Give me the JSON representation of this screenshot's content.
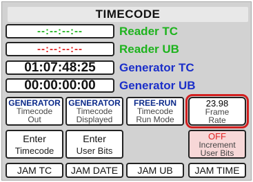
{
  "title": "TIMECODE",
  "colors": {
    "green": "#1db31d",
    "red": "#e22020",
    "blue": "#1b2fc9",
    "navy": "#0c2a8a",
    "black": "#111111",
    "selected_outline": "#d21f1f",
    "pink_bg": "#f7d7d7"
  },
  "timecodes": [
    {
      "value": "--:--:--:--",
      "label": "Reader TC",
      "value_color": "green",
      "label_color": "green"
    },
    {
      "value": "--:--:--:--",
      "label": "Reader UB",
      "value_color": "red",
      "label_color": "green"
    },
    {
      "value": "01:07:48:25",
      "label": "Generator TC",
      "value_color": "black",
      "label_color": "blue"
    },
    {
      "value": "00:00:00:00",
      "label": "Generator UB",
      "value_color": "black",
      "label_color": "blue"
    }
  ],
  "mode_buttons": [
    {
      "line1": "GENERATOR",
      "line2": "Timecode",
      "line3": "Out"
    },
    {
      "line1": "GENERATOR",
      "line2": "Timecode",
      "line3": "Displayed"
    },
    {
      "line1": "FREE-RUN",
      "line2": "Timecode",
      "line3": "Run Mode"
    },
    {
      "line1": "23.98",
      "line2": "Frame",
      "line3": "Rate",
      "selected": true
    }
  ],
  "enter_buttons": [
    {
      "line1": "Enter",
      "line2": "Timecode"
    },
    {
      "line1": "Enter",
      "line2": "User Bits"
    },
    {
      "line1": "OFF",
      "line2": "Increment",
      "line3": "User Bits"
    }
  ],
  "jam_buttons": [
    "JAM TC",
    "JAM DATE",
    "JAM UB",
    "JAM TIME"
  ]
}
